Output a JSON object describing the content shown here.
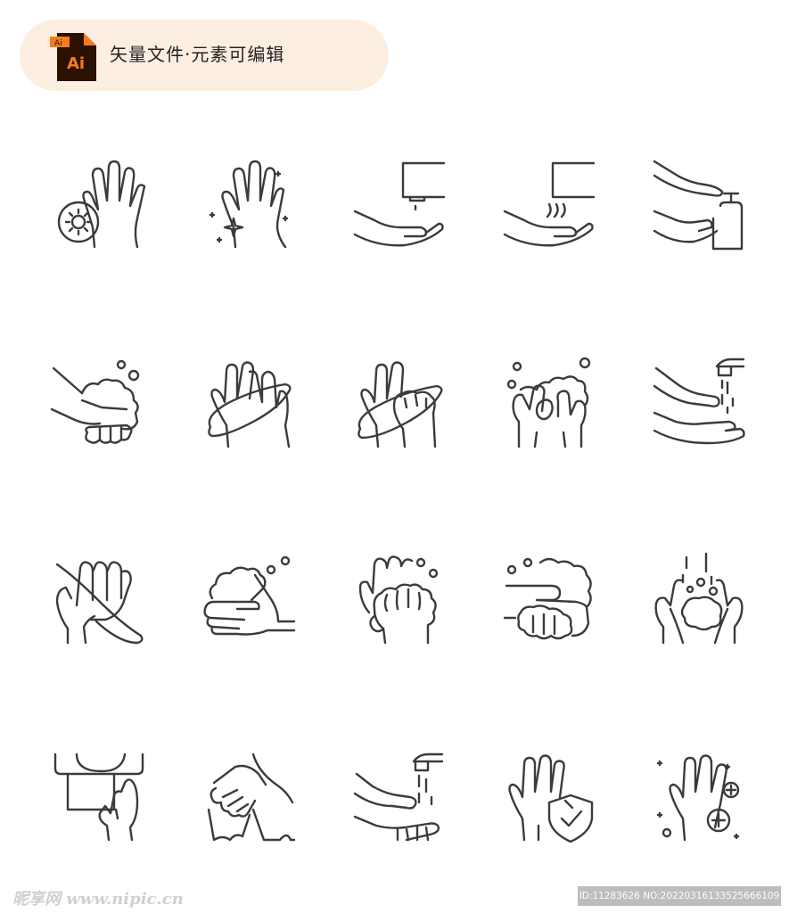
{
  "header": {
    "file_icon_label": "Ai",
    "file_icon_tag": "Ai",
    "title": "矢量文件·元素可编辑"
  },
  "icons": [
    {
      "name": "hand-virus-icon"
    },
    {
      "name": "clean-sparkle-hand-icon"
    },
    {
      "name": "hand-under-dispenser-icon"
    },
    {
      "name": "hand-dryer-icon"
    },
    {
      "name": "soap-pump-hands-icon"
    },
    {
      "name": "soapy-handshake-icon"
    },
    {
      "name": "rub-palms-icon"
    },
    {
      "name": "rub-back-hand-icon"
    },
    {
      "name": "interlace-fingers-foam-icon"
    },
    {
      "name": "rinse-under-tap-icon"
    },
    {
      "name": "clasp-fingers-icon"
    },
    {
      "name": "foam-hands-icon"
    },
    {
      "name": "scrub-fingertips-icon"
    },
    {
      "name": "foam-fist-icon"
    },
    {
      "name": "water-drops-hands-icon"
    },
    {
      "name": "paper-towel-dispenser-icon"
    },
    {
      "name": "towel-dry-hands-icon"
    },
    {
      "name": "tap-running-water-icon"
    },
    {
      "name": "shield-check-hand-icon"
    },
    {
      "name": "hand-health-plus-icon"
    }
  ],
  "watermark": {
    "left": "昵享网 www.nipic.cn",
    "right": "ID:11283626 NO:20220316133525666109"
  },
  "colors": {
    "badge_bg": "#fdeee2",
    "ai_orange": "#f57c1f",
    "ai_dark": "#2b1200",
    "stroke": "#3b3b3b"
  }
}
